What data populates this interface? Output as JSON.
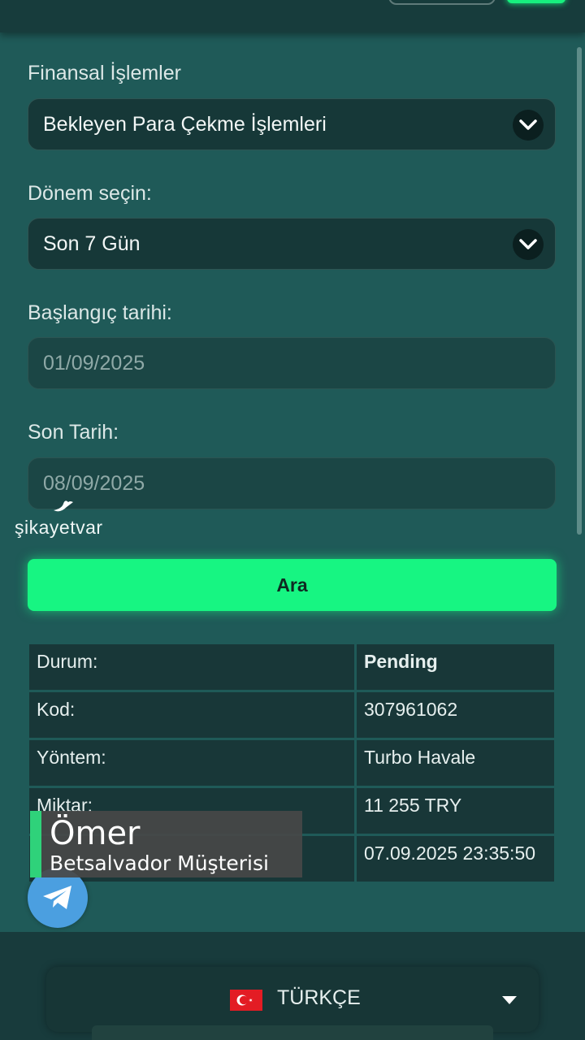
{
  "filters": {
    "financial_label": "Finansal İşlemler",
    "financial_value": "Bekleyen Para Çekme İşlemleri",
    "period_label": "Dönem seçin:",
    "period_value": "Son 7 Gün",
    "start_label": "Başlangıç tarihi:",
    "start_value": "01/09/2025",
    "end_label": "Son Tarih:",
    "end_value": "08/09/2025"
  },
  "watermark": "şikayetvar",
  "search_button": "Ara",
  "result_table": [
    {
      "key": "Durum:",
      "value": "Pending"
    },
    {
      "key": "Kod:",
      "value": "307961062"
    },
    {
      "key": "Yöntem:",
      "value": "Turbo Havale"
    },
    {
      "key": "Miktar:",
      "value": "11 255 TRY"
    },
    {
      "key": "",
      "value": "07.09.2025 23:35:50"
    }
  ],
  "caption": {
    "name": "Ömer",
    "subtitle": "Betsalvador Müşterisi"
  },
  "language": {
    "label": "TÜRKÇE",
    "flag_icon": "turkey-flag-icon"
  },
  "colors": {
    "accent_green": "#17f582",
    "telegram_blue": "#4b9fe0"
  }
}
